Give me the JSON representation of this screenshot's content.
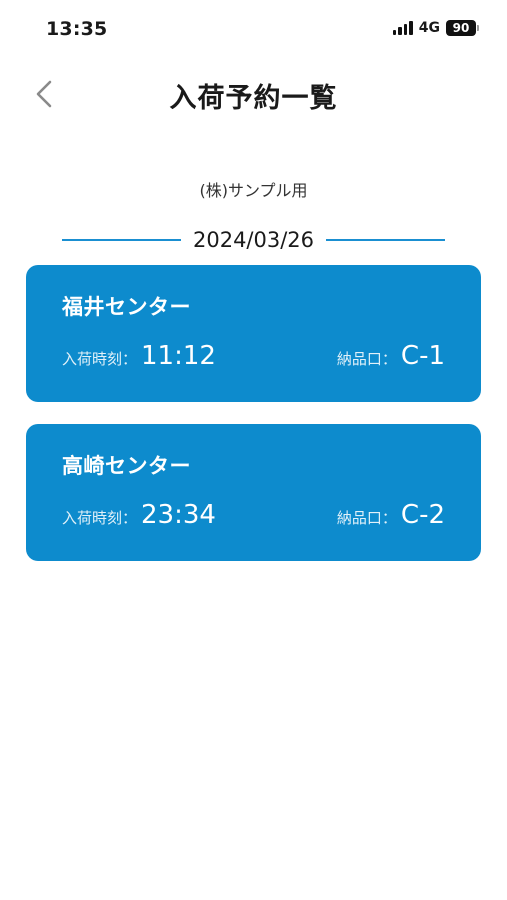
{
  "status_bar": {
    "time": "13:35",
    "network": "4G",
    "battery": "90"
  },
  "header": {
    "back_icon": "chevron-left-icon",
    "title": "入荷予約一覧"
  },
  "company": "(株)サンプル用",
  "date": "2024/03/26",
  "colors": {
    "accent": "#0d8bcd",
    "divider": "#1a8fd1"
  },
  "reservations": [
    {
      "center": "福井センター",
      "time_label": "入荷時刻：",
      "time": "11:12",
      "dock_label": "納品口：",
      "dock": "C-1"
    },
    {
      "center": "高崎センター",
      "time_label": "入荷時刻：",
      "time": "23:34",
      "dock_label": "納品口：",
      "dock": "C-2"
    }
  ]
}
